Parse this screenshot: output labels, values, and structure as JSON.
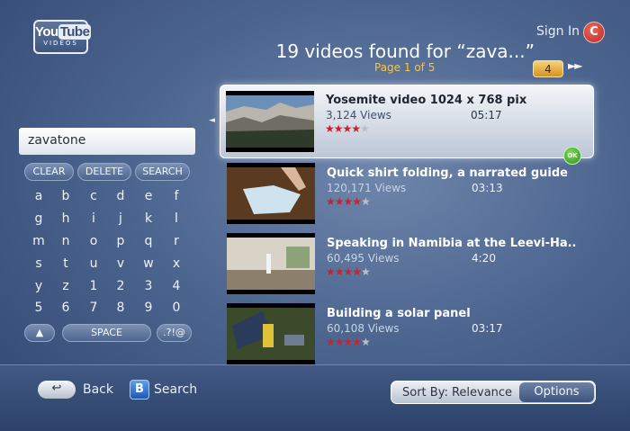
{
  "brand": {
    "logo_top_you": "You",
    "logo_top_tube": "Tube",
    "logo_sub": "VIDEOS"
  },
  "header": {
    "sign_in": "Sign In",
    "sign_in_button": "C",
    "results_title": "19 videos found for “zava...”",
    "page_info": "Page 1 of 5",
    "page_count": "4",
    "next_icon": "fast-forward"
  },
  "search": {
    "value": "zavatone"
  },
  "keyboard": {
    "actions": [
      "CLEAR",
      "DELETE",
      "SEARCH"
    ],
    "rows": [
      [
        "a",
        "b",
        "c",
        "d",
        "e",
        "f"
      ],
      [
        "g",
        "h",
        "i",
        "j",
        "k",
        "l"
      ],
      [
        "m",
        "n",
        "o",
        "p",
        "q",
        "r"
      ],
      [
        "s",
        "t",
        "u",
        "v",
        "w",
        "x"
      ],
      [
        "y",
        "z",
        "1",
        "2",
        "3",
        "4"
      ],
      [
        "5",
        "6",
        "7",
        "8",
        "9",
        "0"
      ]
    ],
    "shift_icon": "▲",
    "space": "SPACE",
    "symbols": ".?!@"
  },
  "results": [
    {
      "title": "Yosemite video 1024 x 768 pix",
      "views": "3,124 Views",
      "duration": "05:17",
      "rating": 3.5,
      "selected": true
    },
    {
      "title": "Quick shirt folding, a narrated guide",
      "views": "120,171 Views",
      "duration": "03:13",
      "rating": 3.5,
      "selected": false
    },
    {
      "title": "Speaking in Namibia at the Leevi-Ha..",
      "views": "60,495 Views",
      "duration": "4:20",
      "rating": 3.5,
      "selected": false
    },
    {
      "title": "Building a solar panel",
      "views": "60,108 Views",
      "duration": "03:17",
      "rating": 3.5,
      "selected": false
    }
  ],
  "ok_badge": "OK",
  "footer": {
    "back_label": "Back",
    "b_button": "B",
    "search_label": "Search",
    "sort_label": "Sort By: Relevance",
    "options_label": "Options"
  },
  "colors": {
    "accent": "#f5c349",
    "star": "#c4242b",
    "sign_in": "#c4302b"
  }
}
